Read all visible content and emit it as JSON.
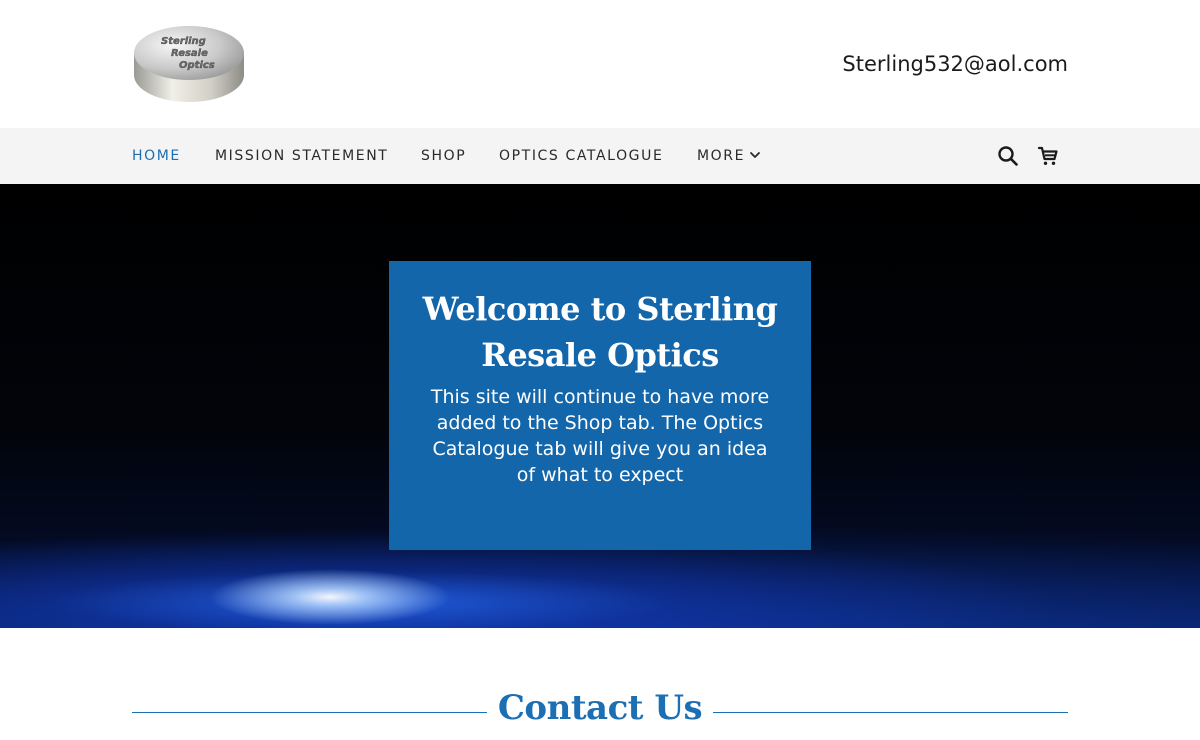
{
  "header": {
    "logo_text_lines": [
      "Sterling",
      "Resale",
      "Optics"
    ],
    "email": "Sterling532@aol.com"
  },
  "nav": {
    "items": [
      {
        "label": "HOME",
        "active": true
      },
      {
        "label": "MISSION STATEMENT",
        "active": false
      },
      {
        "label": "SHOP",
        "active": false
      },
      {
        "label": "OPTICS CATALOGUE",
        "active": false
      },
      {
        "label": "MORE",
        "active": false
      }
    ],
    "icons": [
      "search-icon",
      "cart-icon",
      "chevron-down-icon"
    ]
  },
  "hero": {
    "title": "Welcome to Sterling Resale Optics",
    "text": "This site will continue to have more added to the Shop tab.  The Optics Catalogue tab will give you an idea of what to expect"
  },
  "contact": {
    "title": "Contact Us"
  },
  "colors": {
    "accent": "#1c6fb3",
    "hero_box": "#1466ab",
    "nav_bg": "#f4f4f4"
  }
}
